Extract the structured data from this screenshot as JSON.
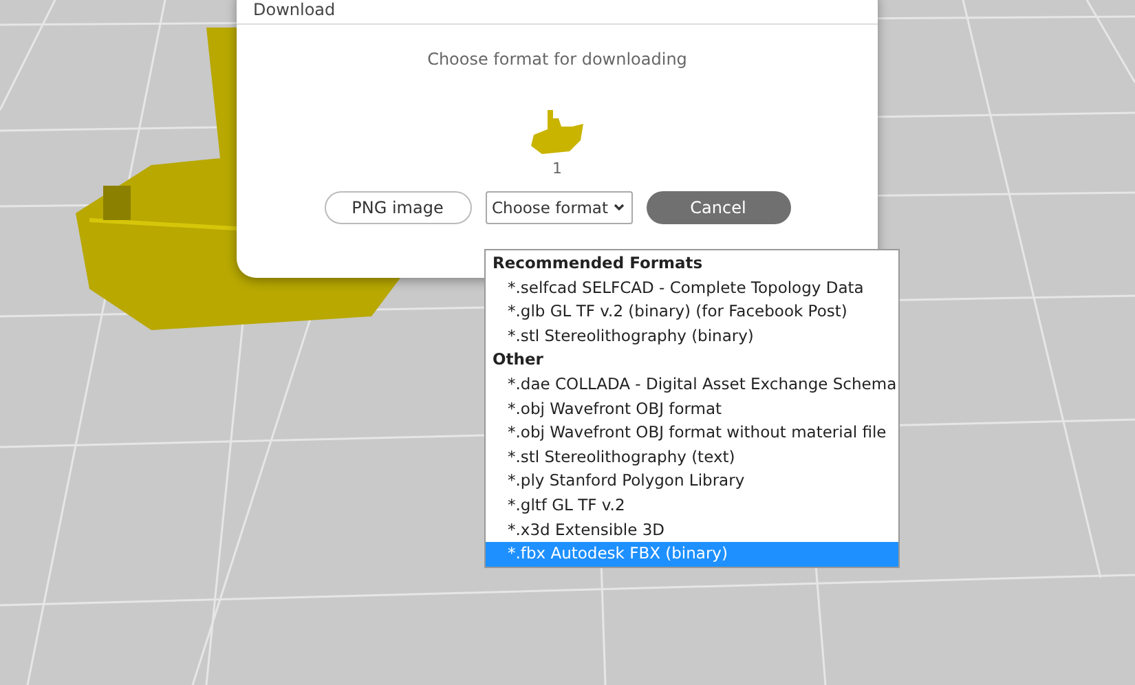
{
  "dialog": {
    "title": "Download",
    "prompt": "Choose format for downloading",
    "thumbnail_caption": "1",
    "buttons": [
      {
        "kind": "outline",
        "label": "PNG image"
      },
      {
        "kind": "select",
        "label": "Choose format"
      },
      {
        "kind": "filled",
        "label": "Cancel"
      }
    ]
  },
  "format_menu": {
    "groups": [
      {
        "label": "Recommended Formats",
        "options": [
          {
            "label": "*.selfcad SELFCAD - Complete Topology Data",
            "selected": false
          },
          {
            "label": "*.glb GL TF v.2 (binary) (for Facebook Post)",
            "selected": false
          },
          {
            "label": "*.stl Stereolithography (binary)",
            "selected": false
          }
        ]
      },
      {
        "label": "Other",
        "options": [
          {
            "label": "*.dae COLLADA - Digital Asset Exchange Schema",
            "selected": false
          },
          {
            "label": "*.obj Wavefront OBJ format",
            "selected": false
          },
          {
            "label": "*.obj Wavefront OBJ format without material file",
            "selected": false
          },
          {
            "label": "*.stl Stereolithography (text)",
            "selected": false
          },
          {
            "label": "*.ply Stanford Polygon Library",
            "selected": false
          },
          {
            "label": "*.gltf GL TF v.2",
            "selected": false
          },
          {
            "label": "*.x3d Extensible 3D",
            "selected": false
          },
          {
            "label": "*.fbx Autodesk FBX (binary)",
            "selected": true
          }
        ]
      }
    ]
  }
}
